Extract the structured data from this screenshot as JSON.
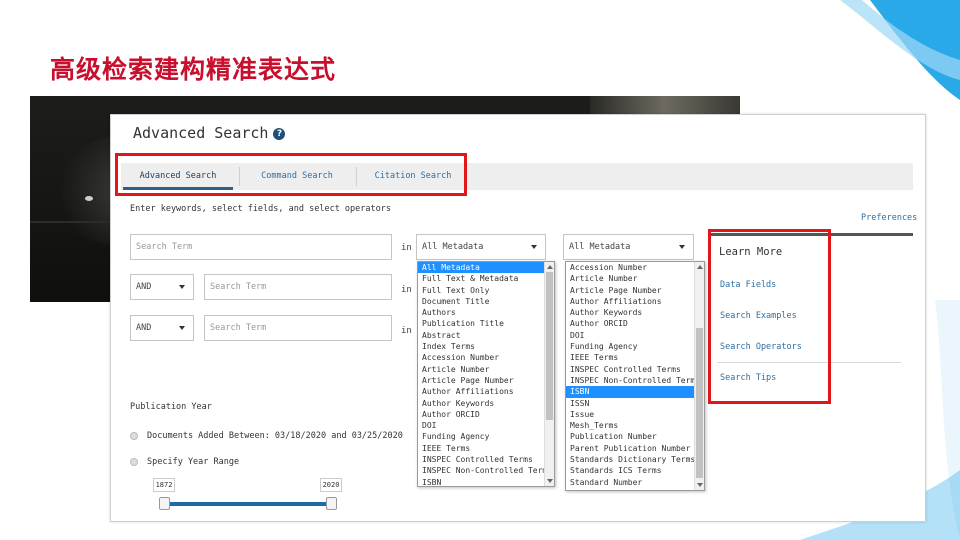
{
  "slide": {
    "title": "高级检索建构精准表达式"
  },
  "panel": {
    "title": "Advanced Search",
    "help_glyph": "?",
    "tabs": [
      {
        "label": "Advanced Search"
      },
      {
        "label": "Command Search"
      },
      {
        "label": "Citation Search"
      }
    ],
    "instructions": "Enter keywords, select fields, and select operators",
    "preferences": "Preferences",
    "rows": [
      {
        "term_placeholder": "Search Term",
        "in_label": "in",
        "field": "All Metadata"
      },
      {
        "operator": "AND",
        "term_placeholder": "Search Term",
        "in_label": "in"
      },
      {
        "operator": "AND",
        "term_placeholder": "Search Term",
        "in_label": "in"
      }
    ],
    "second_field_select": "All Metadata",
    "dropdown1": [
      "All Metadata",
      "Full Text & Metadata",
      "Full Text Only",
      "Document Title",
      "Authors",
      "Publication Title",
      "Abstract",
      "Index Terms",
      "Accession Number",
      "Article Number",
      "Article Page Number",
      "Author Affiliations",
      "Author Keywords",
      "Author ORCID",
      "DOI",
      "Funding Agency",
      "IEEE Terms",
      "INSPEC Controlled Terms",
      "INSPEC Non-Controlled Terms",
      "ISBN"
    ],
    "dropdown1_highlight": 0,
    "dropdown2": [
      "Accession Number",
      "Article Number",
      "Article Page Number",
      "Author Affiliations",
      "Author Keywords",
      "Author ORCID",
      "DOI",
      "Funding Agency",
      "IEEE Terms",
      "INSPEC Controlled Terms",
      "INSPEC Non-Controlled Terms",
      "ISBN",
      "ISSN",
      "Issue",
      "Mesh_Terms",
      "Publication Number",
      "Parent Publication Number",
      "Standards Dictionary Terms",
      "Standards ICS Terms",
      "Standard Number"
    ],
    "dropdown2_highlight": 11,
    "learn_more": {
      "title": "Learn More",
      "links": [
        "Data Fields",
        "Search Examples",
        "Search Operators",
        "Search Tips"
      ]
    },
    "publication_year": {
      "label": "Publication Year",
      "option1": "Documents Added Between: 03/18/2020 and 03/25/2020",
      "option2": "Specify Year Range",
      "range_min": "1872",
      "range_max": "2020"
    }
  },
  "colors": {
    "accent_red": "#e0161b",
    "title_red": "#c8102e",
    "link_blue": "#2d6ea3",
    "highlight": "#1e90ff",
    "slider": "#1f6aa0"
  }
}
